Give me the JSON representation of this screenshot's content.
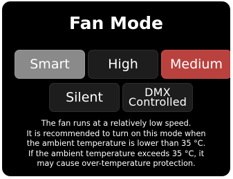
{
  "title": "Fan Mode",
  "buttons": {
    "smart": "Smart",
    "high": "High",
    "medium": "Medium",
    "silent": "Silent",
    "dmx_line1": "DMX",
    "dmx_line2": "Controlled"
  },
  "description": {
    "line1": "The fan runs at a relatively low speed.",
    "line2": "It is recommended to turn on this mode when",
    "line3": "the ambient temperature is lower than 35 °C.",
    "line4": "If the ambient temperature exceeds 35 °C, it",
    "line5": "may cause over-temperature protection."
  },
  "colors": {
    "screen_bg": "#000000",
    "button_bg": "#1d1d1d",
    "smart_bg": "#8a8a8a",
    "selected_bg": "#b9423f",
    "text": "#ffffff"
  }
}
